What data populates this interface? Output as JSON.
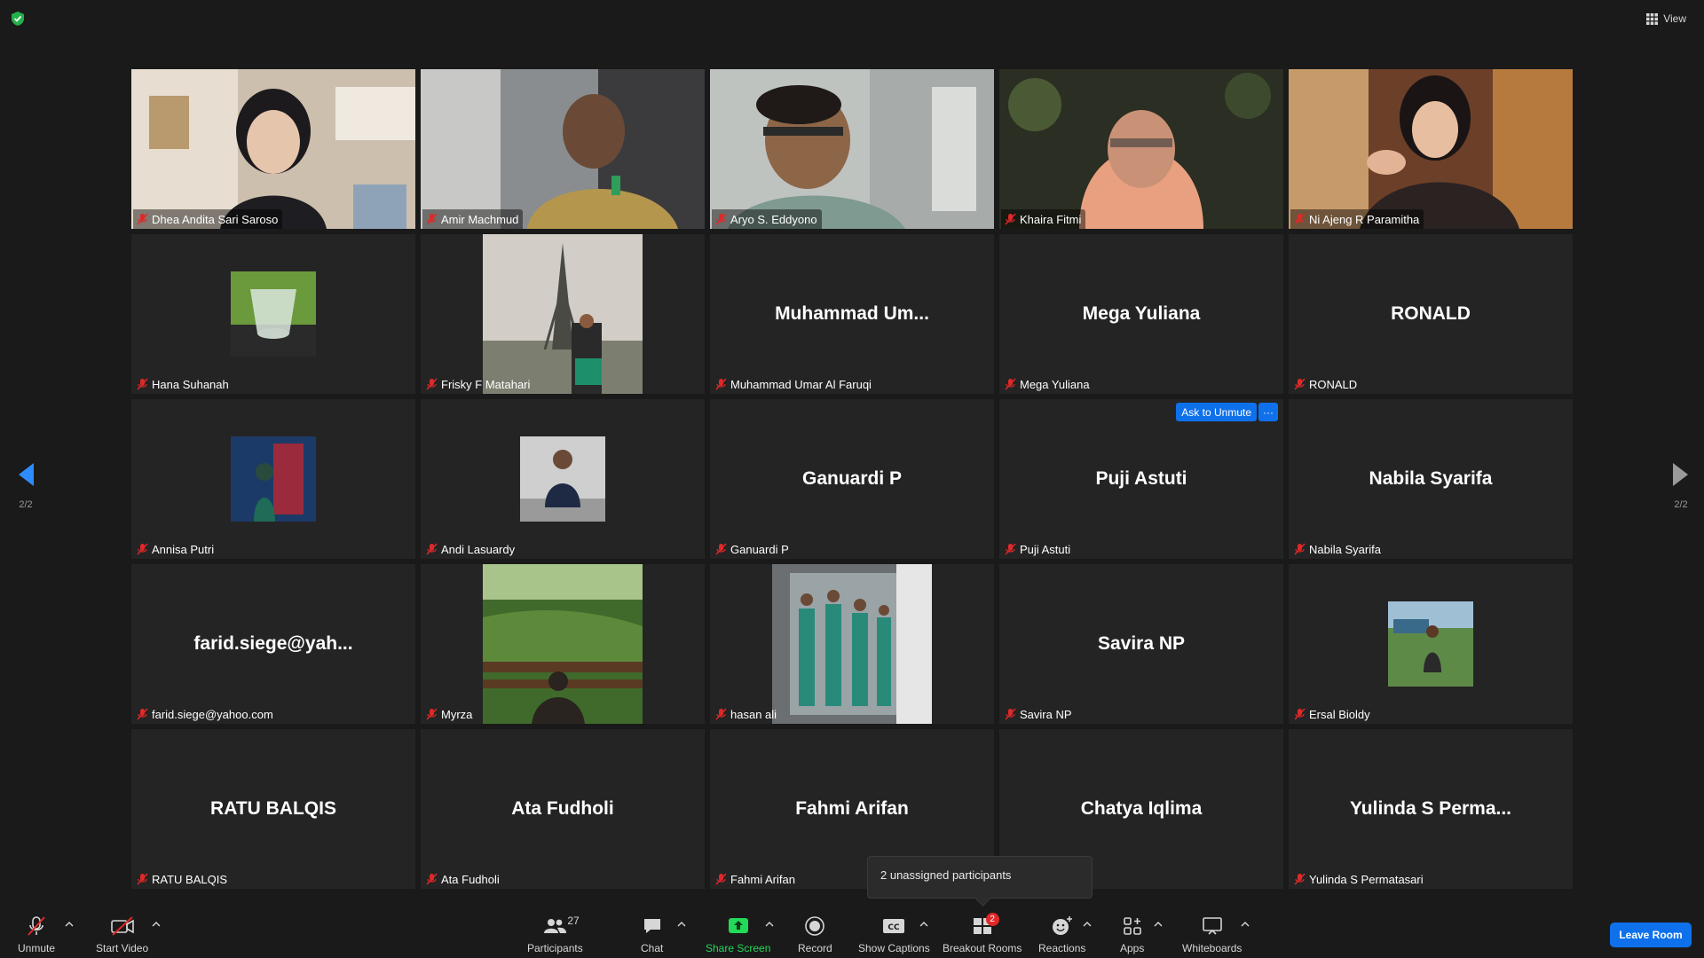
{
  "top": {
    "view_label": "View"
  },
  "pager": {
    "left_text": "2/2",
    "right_text": "2/2"
  },
  "tiles": [
    {
      "label": "Dhea Andita Sari Saroso"
    },
    {
      "label": "Amir Machmud"
    },
    {
      "label": "Aryo S. Eddyono"
    },
    {
      "label": "Khaira Fitmi"
    },
    {
      "label": "Ni Ajeng R Paramitha"
    },
    {
      "label": "Hana Suhanah"
    },
    {
      "label": "Frisky F Matahari"
    },
    {
      "label": "Muhammad Umar Al Faruqi",
      "display": "Muhammad  Um..."
    },
    {
      "label": "Mega Yuliana",
      "display": "Mega Yuliana"
    },
    {
      "label": "RONALD",
      "display": "RONALD"
    },
    {
      "label": "Annisa Putri"
    },
    {
      "label": "Andi Lasuardy"
    },
    {
      "label": "Ganuardi P",
      "display": "Ganuardi P"
    },
    {
      "label": "Puji Astuti",
      "display": "Puji Astuti",
      "ask_unmute": "Ask to Unmute",
      "more": "···"
    },
    {
      "label": "Nabila Syarifa",
      "display": "Nabila Syarifa"
    },
    {
      "label": "farid.siege@yahoo.com",
      "display": "farid.siege@yah..."
    },
    {
      "label": "Myrza"
    },
    {
      "label": "hasan ali"
    },
    {
      "label": "Savira NP",
      "display": "Savira NP"
    },
    {
      "label": "Ersal Bioldy"
    },
    {
      "label": "RATU BALQIS",
      "display": "RATU BALQIS"
    },
    {
      "label": "Ata Fudholi",
      "display": "Ata Fudholi"
    },
    {
      "label": "Fahmi Arifan",
      "display": "Fahmi Arifan"
    },
    {
      "label": "Chatya Iqlima",
      "display": "Chatya Iqlima"
    },
    {
      "label": "Yulinda S Permatasari",
      "display": "Yulinda  S  Perma..."
    }
  ],
  "tooltip": {
    "text": "2 unassigned participants"
  },
  "toolbar": {
    "unmute": "Unmute",
    "start_video": "Start Video",
    "participants": "Participants",
    "participants_count": "27",
    "chat": "Chat",
    "share_screen": "Share Screen",
    "record": "Record",
    "show_captions": "Show Captions",
    "breakout_rooms": "Breakout Rooms",
    "breakout_badge": "2",
    "reactions": "Reactions",
    "apps": "Apps",
    "whiteboards": "Whiteboards",
    "leave_room": "Leave Room"
  },
  "colors": {
    "accent": "#0e71eb",
    "share_green": "#23d959",
    "muted_red": "#e02828",
    "tile_bg": "#242424",
    "window_bg": "#1a1a1a"
  }
}
